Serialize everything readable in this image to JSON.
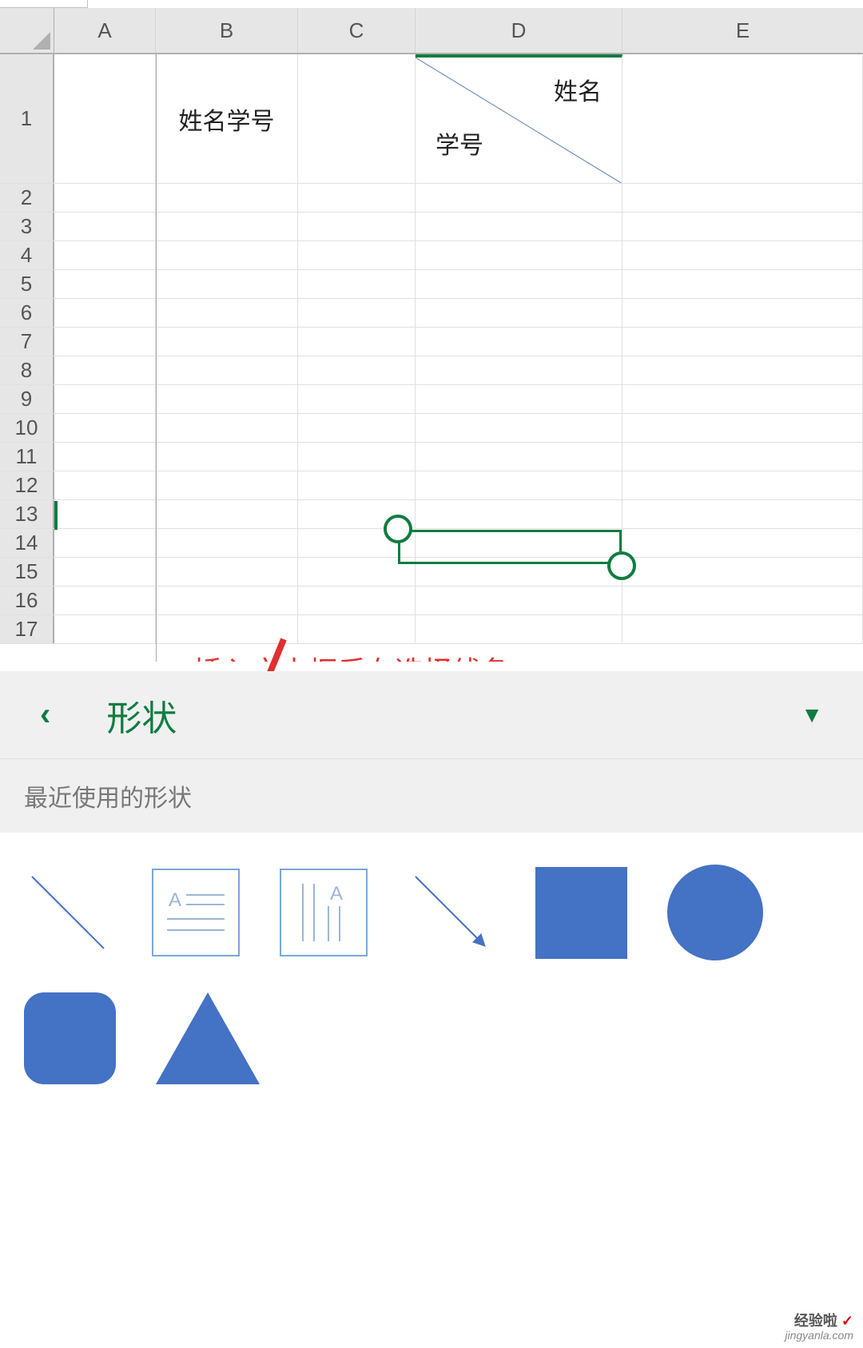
{
  "columns": [
    "A",
    "B",
    "C",
    "D",
    "E"
  ],
  "rows": [
    1,
    2,
    3,
    4,
    5,
    6,
    7,
    8,
    9,
    10,
    11,
    12,
    13,
    14,
    15,
    16,
    17
  ],
  "cells": {
    "b1": "姓名学号",
    "d1_top": "姓名",
    "d1_bottom": "学号"
  },
  "annotation": "插入文本框后在选择线条",
  "panel": {
    "title": "形状",
    "section_label": "最近使用的形状",
    "back_icon": "‹",
    "dropdown_icon": "▼"
  },
  "shapes": {
    "line": "line-shape",
    "textbox_h": "horizontal-textbox",
    "textbox_v": "vertical-textbox",
    "arrow": "arrow-line-shape",
    "square": "rectangle-shape",
    "circle": "oval-shape",
    "rounded": "rounded-rectangle-shape",
    "triangle": "triangle-shape"
  },
  "watermark": {
    "brand": "经验啦",
    "check": "✓",
    "domain": "jingyanla.com"
  },
  "textbox_letter": "A"
}
